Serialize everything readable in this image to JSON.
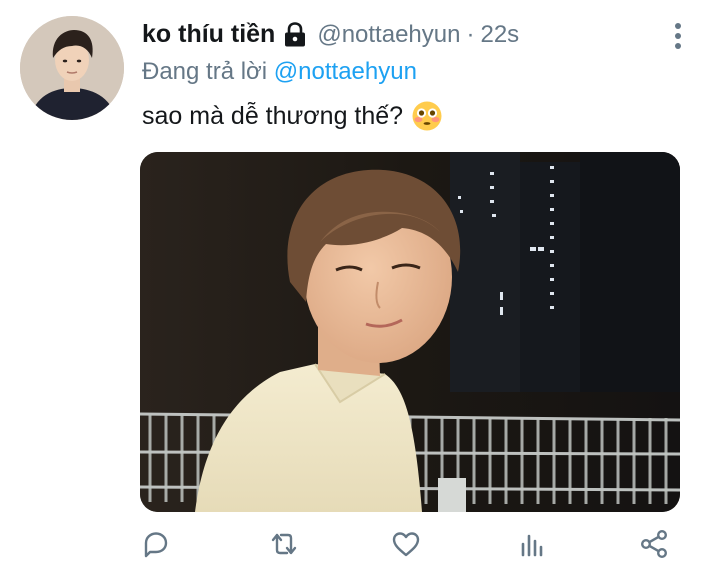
{
  "tweet": {
    "author": {
      "display_name": "ko thíu tiền",
      "handle": "@nottaehyun",
      "protected_icon": "lock-icon",
      "avatar": "profile-photo"
    },
    "separator": "·",
    "timestamp": "22s",
    "reply_prefix": "Đang trả lời",
    "reply_to": "@nottaehyun",
    "text": "sao mà dễ thương thế?",
    "emoji": "flushed-face",
    "media": "photo",
    "more_icon": "more-vertical-icon"
  },
  "actions": [
    {
      "name": "reply",
      "icon": "comment-icon"
    },
    {
      "name": "retweet",
      "icon": "retweet-icon"
    },
    {
      "name": "like",
      "icon": "heart-icon"
    },
    {
      "name": "analytics",
      "icon": "bar-chart-icon"
    },
    {
      "name": "share",
      "icon": "share-icon"
    }
  ],
  "colors": {
    "text": "#14171a",
    "muted": "#657786",
    "link": "#1da1f2",
    "icon": "#657786"
  }
}
